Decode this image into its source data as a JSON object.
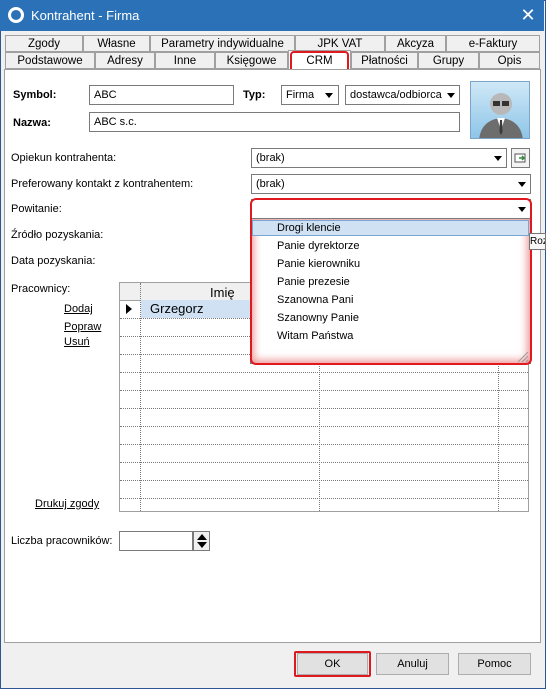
{
  "window": {
    "title": "Kontrahent - Firma"
  },
  "tabs_row1": [
    "Zgody",
    "Własne",
    "Parametry indywidualne",
    "JPK VAT",
    "Akcyza",
    "e-Faktury"
  ],
  "tabs_row2": [
    "Podstawowe",
    "Adresy",
    "Inne",
    "Księgowe",
    "CRM",
    "Płatności",
    "Grupy",
    "Opis"
  ],
  "active_tab": "CRM",
  "header": {
    "symbol_label": "Symbol:",
    "symbol_value": "ABC",
    "typ_label": "Typ:",
    "typ_value": "Firma",
    "rodzaj_value": "dostawca/odbiorca",
    "nazwa_label": "Nazwa:",
    "nazwa_value": "ABC s.c."
  },
  "crm": {
    "opiekun_label": "Opiekun kontrahenta:",
    "opiekun_value": "(brak)",
    "kontakt_label": "Preferowany kontakt z kontrahentem:",
    "kontakt_value": "(brak)",
    "powitanie_label": "Powitanie:",
    "zrodlo_label": "Źródło pozyskania:",
    "data_label": "Data pozyskania:",
    "pracownicy_label": "Pracownicy:",
    "dodaj": "Dodaj",
    "popraw": "Popraw",
    "usun": "Usuń",
    "drukuj": "Drukuj zgody",
    "liczba_label": "Liczba pracowników:",
    "liczba_value": ""
  },
  "grid": {
    "column": "Imię",
    "rows": [
      "Grzegorz"
    ]
  },
  "dropdown": {
    "items": [
      "Drogi klencie",
      "Panie dyrektorze",
      "Panie kierowniku",
      "Panie prezesie",
      "Szanowna Pani",
      "Szanowny Panie",
      "Witam Państwa"
    ],
    "tooltip_fragment": "Roz"
  },
  "buttons": {
    "ok": "OK",
    "anuluj": "Anuluj",
    "pomoc": "Pomoc"
  },
  "colors": {
    "titlebar": "#2b71b8",
    "highlight": "#e0191f",
    "selection": "#cfe1f3"
  }
}
